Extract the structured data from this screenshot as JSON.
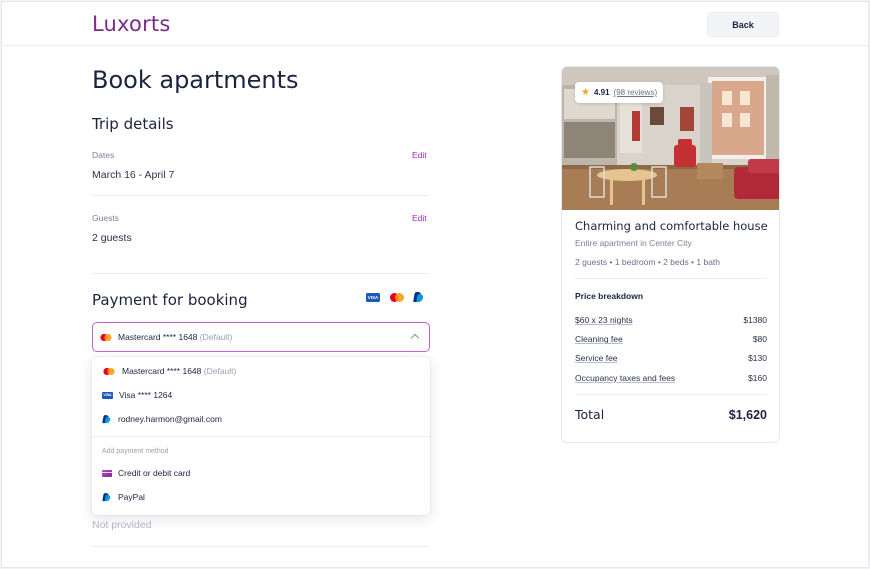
{
  "header": {
    "logo": "Luxorts",
    "back_label": "Back"
  },
  "page": {
    "title": "Book apartments"
  },
  "trip": {
    "title": "Trip details",
    "dates_label": "Dates",
    "dates_value": "March 16 - April 7",
    "guests_label": "Guests",
    "guests_value": "2 guests",
    "edit_label": "Edit"
  },
  "payment": {
    "title": "Payment for booking",
    "card_icons": [
      "visa-icon",
      "mastercard-icon",
      "paypal-icon"
    ],
    "selected": {
      "name": "Mastercard **** 1648",
      "tag": "(Default)"
    },
    "options": [
      {
        "icon": "mastercard-icon",
        "name": "Mastercard **** 1648",
        "tag": "(Default)"
      },
      {
        "icon": "visa-icon",
        "name": "Visa **** 1264",
        "tag": ""
      },
      {
        "icon": "paypal-icon",
        "name": "rodney.harmon@gmail.com",
        "tag": ""
      }
    ],
    "add_group_label": "Add payment method",
    "add_options": [
      {
        "icon": "credit-card-icon",
        "name": "Credit or debit card"
      },
      {
        "icon": "paypal-icon",
        "name": "PayPal"
      }
    ],
    "below_value": "Not provided"
  },
  "listing": {
    "rating": "4.91",
    "reviews": "(98 reviews)",
    "title": "Charming and comfortable house",
    "subtitle": "Entire apartment in Center City",
    "meta": "2 guests • 1 bedroom • 2 beds • 1 bath",
    "price_breakdown_title": "Price breakdown",
    "lines": [
      {
        "label": "$60 x 23 nights",
        "amount": "$1380"
      },
      {
        "label": "Cleaning fee",
        "amount": "$80"
      },
      {
        "label": "Service fee",
        "amount": "$130"
      },
      {
        "label": "Occupancy taxes and fees",
        "amount": "$160"
      }
    ],
    "total_label": "Total",
    "total_amount": "$1,620"
  },
  "colors": {
    "brand": "#7a2d8c",
    "accent": "#9b2fae",
    "select_border": "#c561d6",
    "text": "#1c2340"
  }
}
